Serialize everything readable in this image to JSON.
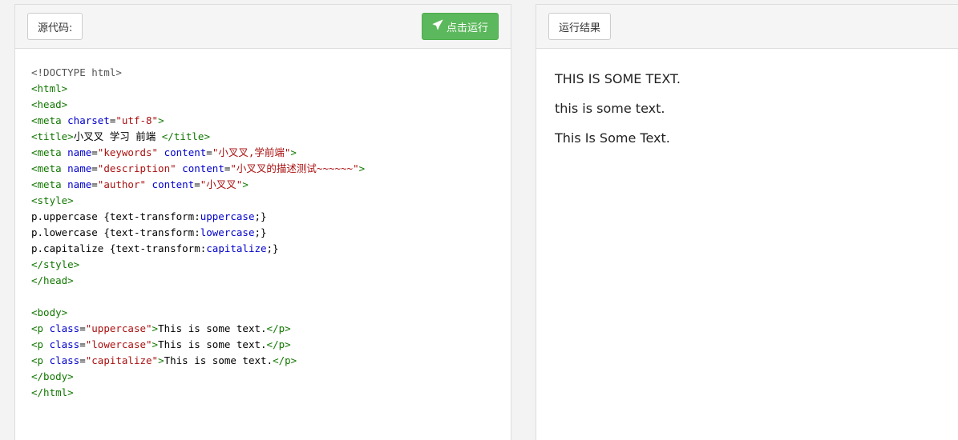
{
  "left_panel": {
    "source_label": "源代码:",
    "run_label": "点击运行"
  },
  "right_panel": {
    "result_label": "运行结果"
  },
  "code": {
    "doctype": "<!DOCTYPE html>",
    "html_open": "<html>",
    "head_open": "<head>",
    "meta_charset_open": "<meta ",
    "meta_charset_attr": "charset",
    "meta_charset_eq": "=",
    "meta_charset_val": "\"utf-8\"",
    "meta_charset_close": ">",
    "title_open": "<title>",
    "title_text": "小叉叉 学习 前端 ",
    "title_close": "</title>",
    "meta_kw_open": "<meta ",
    "meta_kw_name_attr": "name",
    "meta_kw_name_val": "\"keywords\"",
    "meta_kw_content_attr": "content",
    "meta_kw_content_val": "\"小叉叉,学前端\"",
    "meta_kw_close": ">",
    "meta_desc_open": "<meta ",
    "meta_desc_name_attr": "name",
    "meta_desc_name_val": "\"description\"",
    "meta_desc_content_attr": "content",
    "meta_desc_content_val": "\"小叉叉的描述测试~~~~~~\"",
    "meta_desc_close": ">",
    "meta_author_open": "<meta ",
    "meta_author_name_attr": "name",
    "meta_author_name_val": "\"author\"",
    "meta_author_content_attr": "content",
    "meta_author_content_val": "\"小叉叉\"",
    "meta_author_close": ">",
    "style_open": "<style>",
    "css1_sel": "p.uppercase ",
    "css1_open": "{text-transform:",
    "css1_val": "uppercase",
    "css1_close": ";}",
    "css2_sel": "p.lowercase ",
    "css2_open": "{text-transform:",
    "css2_val": "lowercase",
    "css2_close": ";}",
    "css3_sel": "p.capitalize ",
    "css3_open": "{text-transform:",
    "css3_val": "capitalize",
    "css3_close": ";}",
    "style_close": "</style>",
    "head_close": "</head>",
    "body_open": "<body>",
    "p1_open": "<p ",
    "p1_attr": "class",
    "p1_val": "\"uppercase\"",
    "p1_gt": ">",
    "p1_text": "This is some text.",
    "p1_close": "</p>",
    "p2_open": "<p ",
    "p2_attr": "class",
    "p2_val": "\"lowercase\"",
    "p2_gt": ">",
    "p2_text": "This is some text.",
    "p2_close": "</p>",
    "p3_open": "<p ",
    "p3_attr": "class",
    "p3_val": "\"capitalize\"",
    "p3_gt": ">",
    "p3_text": "This is some text.",
    "p3_close": "</p>",
    "body_close": "</body>",
    "html_close": "</html>"
  },
  "result": {
    "line1": "THIS IS SOME TEXT.",
    "line2": "this is some text.",
    "line3": "This Is Some Text."
  },
  "colors": {
    "run_button": "#5cb85c",
    "tag": "#117700",
    "attribute": "#0000cc",
    "string": "#aa1111"
  },
  "icons": {
    "run": "paper-plane-icon"
  }
}
